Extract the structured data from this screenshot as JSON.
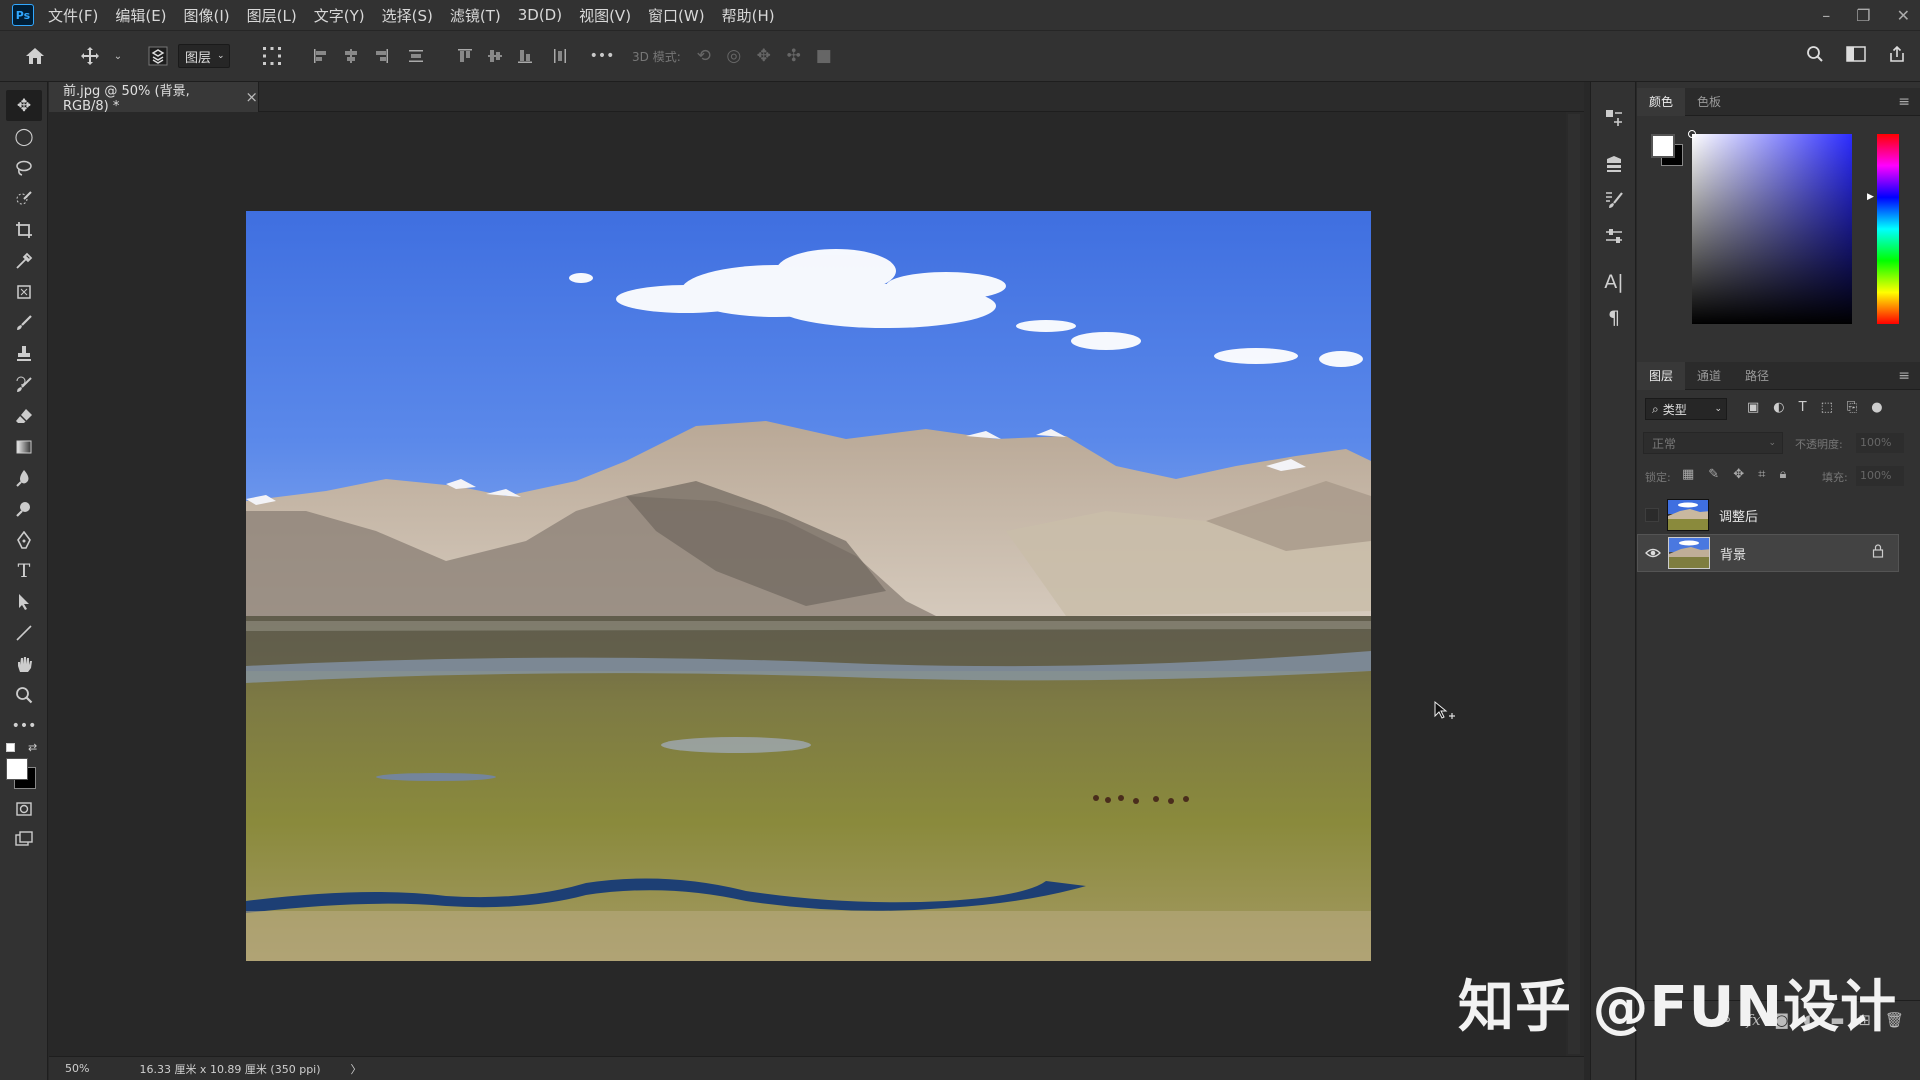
{
  "app": {
    "logo_text": "Ps"
  },
  "menubar": {
    "items": [
      "文件(F)",
      "编辑(E)",
      "图像(I)",
      "图层(L)",
      "文字(Y)",
      "选择(S)",
      "滤镜(T)",
      "3D(D)",
      "视图(V)",
      "窗口(W)",
      "帮助(H)"
    ]
  },
  "window_controls": {
    "minimize": "–",
    "restore": "❐",
    "close": "✕"
  },
  "options": {
    "layer_select_value": "图层",
    "mode3d_label": "3D 模式:",
    "more_label": "•••"
  },
  "document": {
    "tab_title": "前.jpg @ 50% (背景, RGB/8) *",
    "close_glyph": "×"
  },
  "status": {
    "zoom": "50%",
    "doc_info": "16.33 厘米 x 10.89 厘米 (350 ppi)",
    "arrow": "〉"
  },
  "color_panel": {
    "tabs": [
      "颜色",
      "色板"
    ],
    "foreground": "#ffffff",
    "background": "#000000",
    "hue": "#2c2cff"
  },
  "layers_panel": {
    "tabs": [
      "图层",
      "通道",
      "路径"
    ],
    "filter_label": "类型",
    "blend_mode": "正常",
    "opacity_label": "不透明度:",
    "opacity_value": "100%",
    "lock_label": "锁定:",
    "fill_label": "填充:",
    "fill_value": "100%",
    "layers": [
      {
        "name": "调整后",
        "visible": false,
        "locked": false
      },
      {
        "name": "背景",
        "visible": true,
        "locked": true
      }
    ]
  },
  "watermark": {
    "text": "知乎 @FUN设计"
  },
  "colors": {
    "accent": "#31a8ff",
    "ui_bg": "#323232",
    "canvas_bg": "#282828"
  }
}
